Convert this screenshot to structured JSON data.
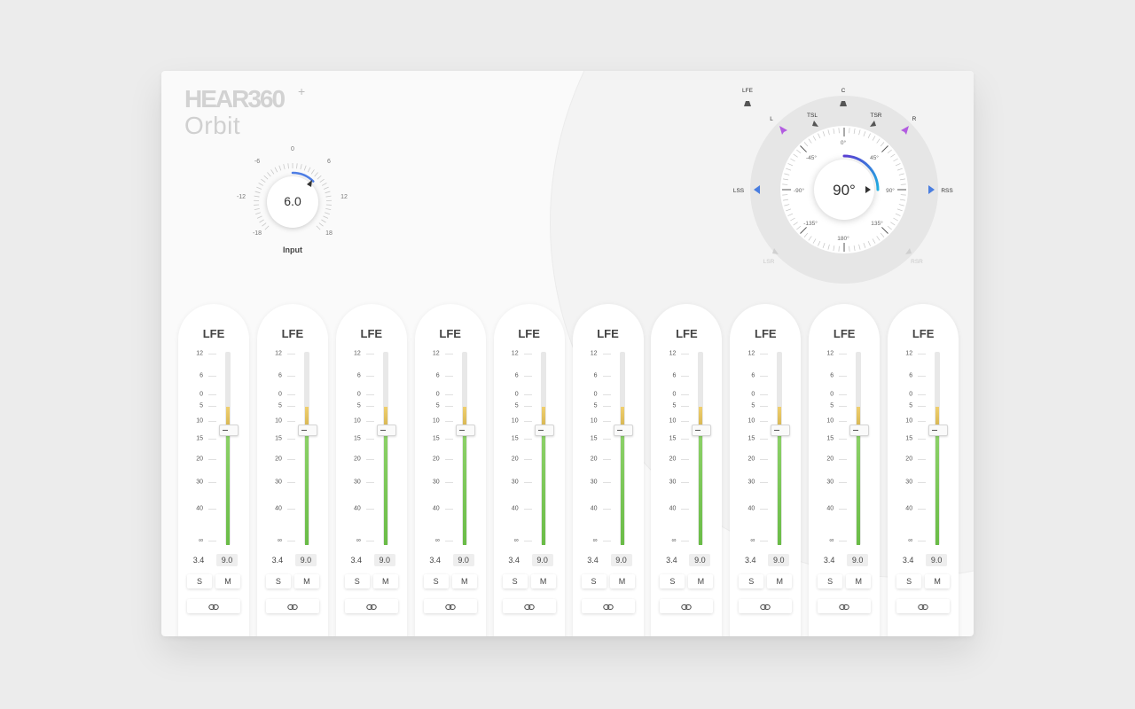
{
  "brand": {
    "title": "HEAR360",
    "plus": "+",
    "subtitle": "Orbit"
  },
  "input_knob": {
    "value": "6.0",
    "label": "Input",
    "scale": [
      "-18",
      "-12",
      "-6",
      "0",
      "6",
      "12",
      "18"
    ]
  },
  "panner": {
    "angle": "90°",
    "ring_labels": [
      "0°",
      "45°",
      "90°",
      "135°",
      "180°",
      "-135°",
      "-90°",
      "-45°"
    ],
    "speakers": [
      "LFE",
      "C",
      "L",
      "R",
      "TSL",
      "TSR",
      "LSS",
      "RSS",
      "LSR",
      "RSR"
    ]
  },
  "channel_scale": [
    "12",
    "6",
    "0",
    "5",
    "10",
    "15",
    "20",
    "30",
    "40",
    "∞"
  ],
  "channels": [
    {
      "name": "LFE",
      "peak": "3.4",
      "gain": "9.0",
      "solo": "S",
      "mute": "M"
    },
    {
      "name": "LFE",
      "peak": "3.4",
      "gain": "9.0",
      "solo": "S",
      "mute": "M"
    },
    {
      "name": "LFE",
      "peak": "3.4",
      "gain": "9.0",
      "solo": "S",
      "mute": "M"
    },
    {
      "name": "LFE",
      "peak": "3.4",
      "gain": "9.0",
      "solo": "S",
      "mute": "M"
    },
    {
      "name": "LFE",
      "peak": "3.4",
      "gain": "9.0",
      "solo": "S",
      "mute": "M"
    },
    {
      "name": "LFE",
      "peak": "3.4",
      "gain": "9.0",
      "solo": "S",
      "mute": "M"
    },
    {
      "name": "LFE",
      "peak": "3.4",
      "gain": "9.0",
      "solo": "S",
      "mute": "M"
    },
    {
      "name": "LFE",
      "peak": "3.4",
      "gain": "9.0",
      "solo": "S",
      "mute": "M"
    },
    {
      "name": "LFE",
      "peak": "3.4",
      "gain": "9.0",
      "solo": "S",
      "mute": "M"
    },
    {
      "name": "LFE",
      "peak": "3.4",
      "gain": "9.0",
      "solo": "S",
      "mute": "M"
    }
  ],
  "colors": {
    "meter_green": "#7cc858",
    "meter_yellow": "#e2c35e",
    "arc_gradient_start": "#5b3fd6",
    "arc_gradient_end": "#1fb4e8",
    "speaker_front": "#b25ce0",
    "speaker_side": "#4a7ee0"
  }
}
